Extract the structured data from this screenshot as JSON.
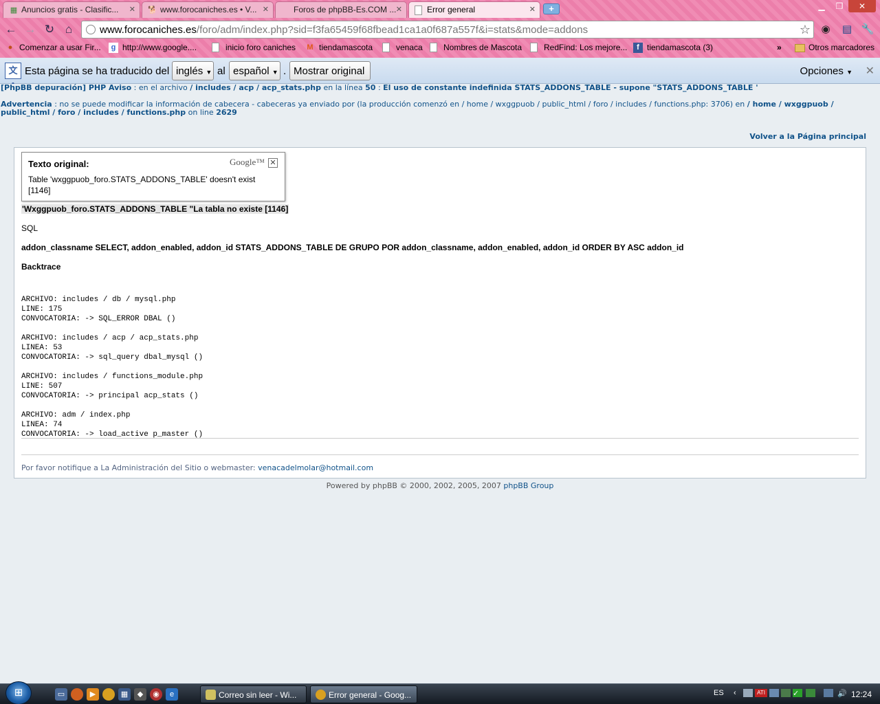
{
  "browser": {
    "tabs": [
      {
        "title": "Anuncios gratis - Clasific...",
        "favicon": "classifieds-icon",
        "active": false
      },
      {
        "title": "www.forocaniches.es • V...",
        "favicon": "dog-icon",
        "active": false
      },
      {
        "title": "Foros de phpBB-Es.COM ...",
        "favicon": "phpbb-icon",
        "active": false
      },
      {
        "title": "Error general",
        "favicon": "page-icon",
        "active": true
      }
    ],
    "url_host": "www.forocaniches.es",
    "url_path": "/foro/adm/index.php?sid=f3fa65459f68fbead1ca1a0f687a557f&i=stats&mode=addons",
    "bookmarks": [
      {
        "label": "Comenzar a usar Fir...",
        "icon": "firefox-icon"
      },
      {
        "label": "http://www.google....",
        "icon": "google-icon"
      },
      {
        "label": "inicio foro caniches",
        "icon": "page-icon"
      },
      {
        "label": "tiendamascota",
        "icon": "magento-icon"
      },
      {
        "label": "venaca",
        "icon": "page-icon"
      },
      {
        "label": "Nombres de Mascota",
        "icon": "page-icon"
      },
      {
        "label": "RedFind: Los mejore...",
        "icon": "page-icon"
      },
      {
        "label": "tiendamascota (3)",
        "icon": "facebook-icon"
      }
    ],
    "bookmarks_overflow": "»",
    "other_bookmarks": "Otros marcadores"
  },
  "translate_bar": {
    "prefix": "Esta página se ha traducido del",
    "from_lang": "inglés",
    "connector": "al",
    "to_lang": "español",
    "dot": ".",
    "show_original": "Mostrar original",
    "options": "Opciones"
  },
  "page": {
    "warn1_bold": "[PhpBB depuración] PHP Aviso",
    "warn1_a": ": en el archivo",
    "warn1_path": "/ includes / acp / acp_stats.php",
    "warn1_b": "en la línea",
    "warn1_line": "50",
    "warn1_c": ":",
    "warn1_msg": "El uso de constante indefinida STATS_ADDONS_TABLE - supone \"STATS_ADDONS_TABLE '",
    "warn2_bold": "Advertencia",
    "warn2_a": ": no se puede modificar la información de cabecera - cabeceras ya enviado por (la producción comenzó en / home / wxggpuob / public_html / foro / includes / functions.php: 3706) en",
    "warn2_path1": "/ home / wxggpuob /",
    "warn2_path2": "public_html / foro / includes / functions.php",
    "warn2_b": "on line",
    "warn2_line": "2629",
    "back_link": "Volver a la Página principal",
    "popup": {
      "title": "Texto original:",
      "logo": "Google™",
      "close": "✕",
      "original": "Table 'wxggpuob_foro.STATS_ADDONS_TABLE' doesn't exist [1146]"
    },
    "error_title": "'Wxggpuob_foro.STATS_ADDONS_TABLE \"La tabla no existe [1146]",
    "sql_label": "SQL",
    "sql_text": "addon_classname SELECT, addon_enabled, addon_id STATS_ADDONS_TABLE DE GRUPO POR addon_classname, addon_enabled, addon_id ORDER BY ASC addon_id",
    "backtrace_label": "Backtrace",
    "trace": [
      "ARCHIVO: includes / db / mysql.php\nLINE: 175\nCONVOCATORIA: -> SQL_ERROR DBAL ()",
      "ARCHIVO: includes / acp / acp_stats.php\nLINEA: 53\nCONVOCATORIA: -> sql_query dbal_mysql ()",
      "ARCHIVO: includes / functions_module.php\nLINE: 507\nCONVOCATORIA: -> principal acp_stats ()",
      "ARCHIVO: adm / index.php\nLINEA: 74\nCONVOCATORIA: -> load_active p_master ()"
    ],
    "notify_text": "Por favor notifique a La Administración del Sitio o webmaster:",
    "notify_email": "venacadelmolar@hotmail.com",
    "powered_text": "Powered by phpBB © 2000, 2002, 2005, 2007",
    "powered_link": "phpBB Group"
  },
  "taskbar": {
    "items": [
      {
        "label": "Correo sin leer - Wi...",
        "icon": "mail-icon",
        "active": false
      },
      {
        "label": "Error general - Goog...",
        "icon": "chrome-icon",
        "active": true
      }
    ],
    "lang": "ES",
    "clock": "12:24"
  },
  "colors": {
    "link": "#105289",
    "chrome_theme": "#f08cb4",
    "translate_bar": "#c9dbef"
  }
}
